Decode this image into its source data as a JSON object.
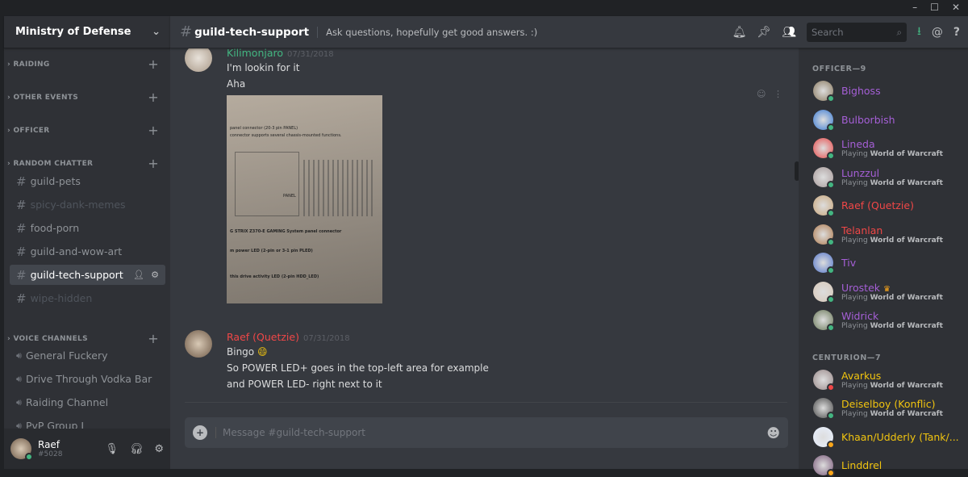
{
  "window": {
    "controls": [
      "–",
      "☐",
      "✕"
    ]
  },
  "sidebar": {
    "guild_name": "Ministry of Defense",
    "categories": [
      {
        "label": "RAIDING"
      },
      {
        "label": "OTHER EVENTS"
      },
      {
        "label": "OFFICER"
      },
      {
        "label": "RANDOM CHATTER"
      },
      {
        "label": "VOICE CHANNELS"
      }
    ],
    "channels": [
      {
        "label": "guild-pets"
      },
      {
        "label": "spicy-dank-memes"
      },
      {
        "label": "food-porn"
      },
      {
        "label": "guild-and-wow-art"
      },
      {
        "label": "guild-tech-support"
      },
      {
        "label": "wipe-hidden"
      }
    ],
    "voice": [
      {
        "label": "General Fuckery"
      },
      {
        "label": "Drive Through Vodka Bar"
      },
      {
        "label": "Raiding Channel"
      },
      {
        "label": "PvP Group I"
      }
    ],
    "user": {
      "name": "Raef",
      "tag": "#5028"
    }
  },
  "header": {
    "channel": "guild-tech-support",
    "topic": "Ask questions, hopefully get good answers. :)",
    "search_placeholder": "Search"
  },
  "messages": [
    {
      "author": "Kilimonjaro",
      "timestamp": "07/31/2018",
      "color": "#43b581",
      "lines": [
        "I'm lookin for it",
        "Aha"
      ]
    },
    {
      "author": "Raef (Quetzie)",
      "timestamp": "07/31/2018",
      "color": "#f04747",
      "lines": [
        "Bingo",
        "So POWER LED+ goes in the top-left area for example",
        "and POWER LED- right next to it"
      ]
    }
  ],
  "attachment_text": [
    "panel connector (20-3 pin PANEL)",
    "connector supports several chassis-mounted functions.",
    "PANEL",
    "G STRIX Z370-E GAMING System panel connector",
    "m power LED (2-pin or 3-1 pin PLED)",
    "this drive activity LED (2-pin HDD_LED)"
  ],
  "composer": {
    "placeholder": "Message #guild-tech-support"
  },
  "members": {
    "groups": [
      {
        "label": "OFFICER—9",
        "members": [
          {
            "name": "Bighoss",
            "color": "#a55fd6",
            "status": "#43b581",
            "game": ""
          },
          {
            "name": "Bulborbish",
            "color": "#a55fd6",
            "status": "#43b581",
            "game": ""
          },
          {
            "name": "Lineda",
            "color": "#a55fd6",
            "status": "#43b581",
            "game": "World of Warcraft"
          },
          {
            "name": "Lunzzul",
            "color": "#a55fd6",
            "status": "#43b581",
            "game": "World of Warcraft"
          },
          {
            "name": "Raef (Quetzie)",
            "color": "#f04747",
            "status": "#43b581",
            "game": ""
          },
          {
            "name": "Telanlan",
            "color": "#f04747",
            "status": "#43b581",
            "game": "World of Warcraft"
          },
          {
            "name": "Tiv",
            "color": "#a55fd6",
            "status": "#43b581",
            "game": ""
          },
          {
            "name": "Urostek",
            "color": "#a55fd6",
            "status": "#43b581",
            "game": "World of Warcraft",
            "crown": "♛"
          },
          {
            "name": "Widrick",
            "color": "#a55fd6",
            "status": "#43b581",
            "game": "World of Warcraft"
          }
        ]
      },
      {
        "label": "CENTURION—7",
        "members": [
          {
            "name": "Avarkus",
            "color": "#f1c40f",
            "status": "#f04747",
            "game": "World of Warcraft"
          },
          {
            "name": "Deiselboy (Konflic)",
            "color": "#f1c40f",
            "status": "#43b581",
            "game": "World of Warcraft"
          },
          {
            "name": "Khaan/Udderly (Tank/...",
            "color": "#f1c40f",
            "status": "#faa61a",
            "game": ""
          },
          {
            "name": "Linddrel",
            "color": "#f1c40f",
            "status": "#faa61a",
            "game": ""
          }
        ]
      }
    ],
    "playing_label": "Playing"
  }
}
